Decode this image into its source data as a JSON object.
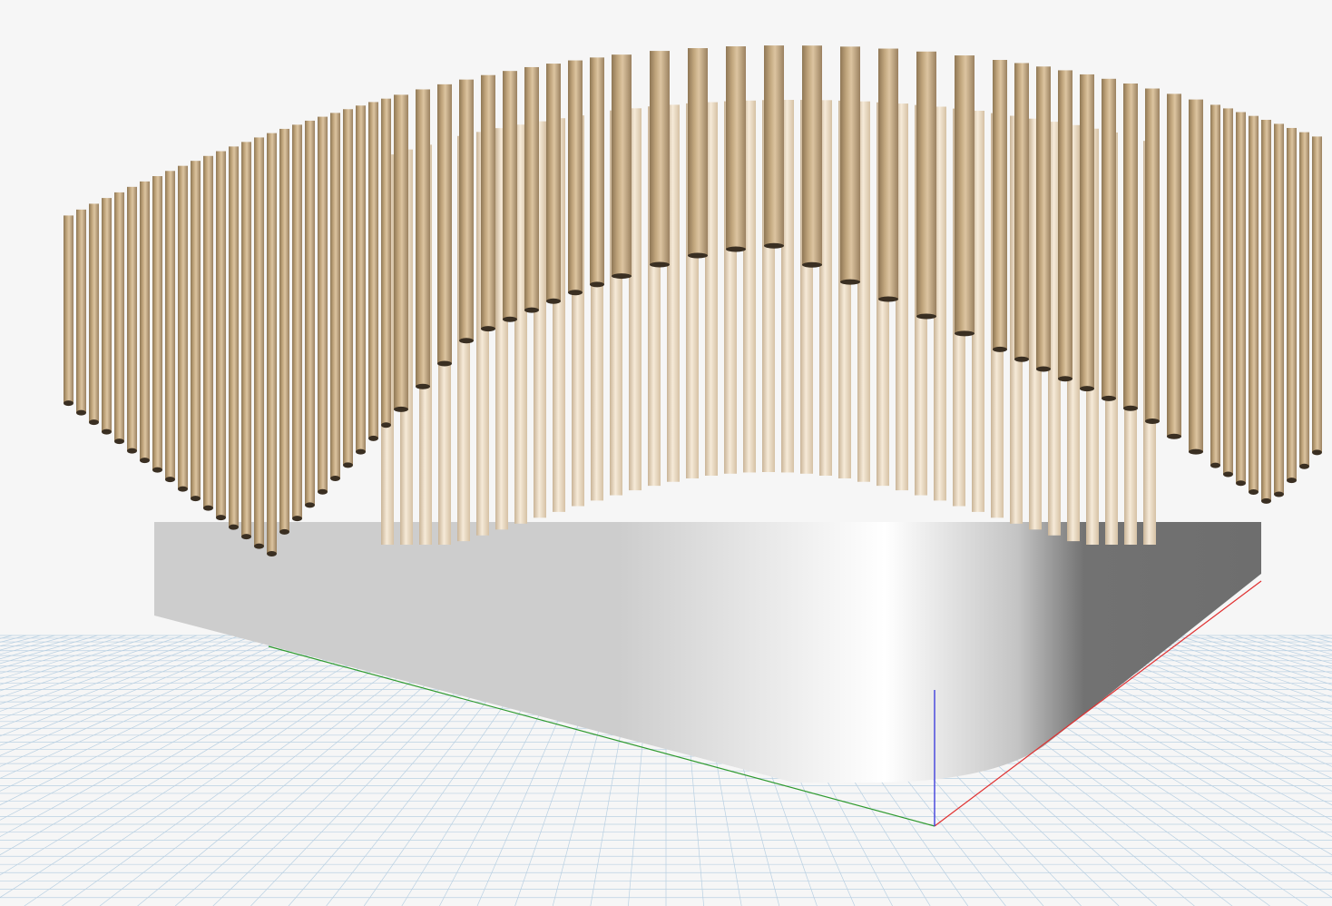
{
  "viewport": {
    "background": "#f6f6f6",
    "grid_color": "#b9d0e2",
    "grid_major_color": "#9fbcd4"
  },
  "axes": {
    "x_color": "#e03030",
    "y_color": "#2f9a2f",
    "z_color": "#3f3fdc"
  },
  "model": {
    "base_slab": {
      "light_color": "#f7f7f7",
      "mid_color": "#cdcdcd",
      "shadow_color": "#6e6e6e"
    },
    "rods": {
      "outer_color": "#c0a57c",
      "outer_highlight": "#dcc4a0",
      "outer_shadow": "#8f7755",
      "inner_color": "#f3e6d3",
      "inner_shadow": "#c9b497"
    }
  }
}
